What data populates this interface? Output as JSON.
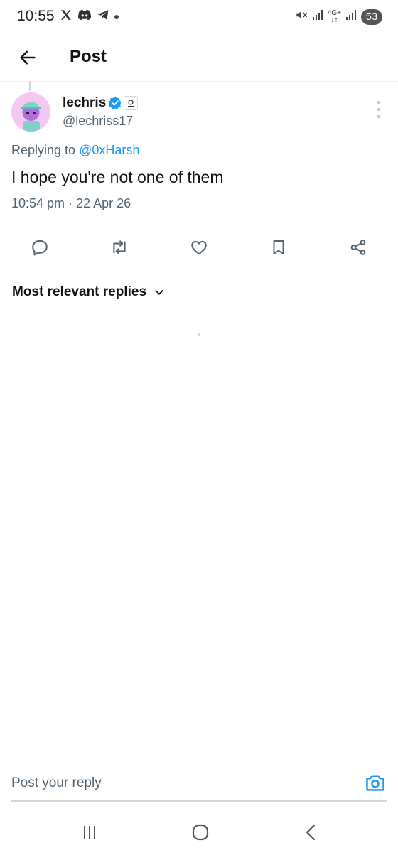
{
  "status_bar": {
    "time": "10:55",
    "left_icons": [
      "x-logo-icon",
      "discord-icon",
      "telegram-icon",
      "dot-icon"
    ],
    "right_icons": [
      "mute-icon",
      "signal-icon",
      "4g-icon",
      "signal-icon"
    ],
    "network_label": "4G+",
    "battery": "53"
  },
  "header": {
    "title": "Post"
  },
  "tweet": {
    "display_name": "lechris",
    "handle": "@lechriss17",
    "replying_prefix": "Replying to ",
    "replying_to": "@0xHarsh",
    "text": "I hope you're not one of them",
    "timestamp": "10:54 pm · 22 Apr 26"
  },
  "actions": [
    "reply-icon",
    "repost-icon",
    "like-icon",
    "bookmark-icon",
    "share-icon"
  ],
  "replies": {
    "sort_label": "Most relevant replies"
  },
  "composer": {
    "placeholder": "Post your reply"
  },
  "colors": {
    "accent": "#1d9bf0",
    "text": "#0f1419",
    "secondary": "#536471"
  }
}
